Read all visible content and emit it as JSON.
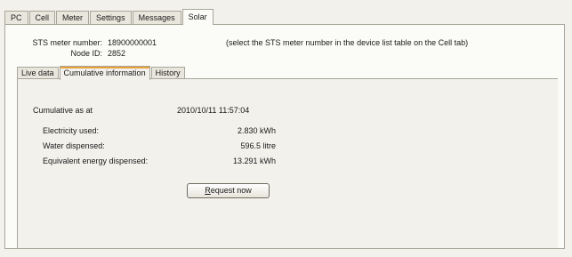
{
  "top_tabs": [
    "PC",
    "Cell",
    "Meter",
    "Settings",
    "Messages",
    "Solar"
  ],
  "meter": {
    "sts_label": "STS meter number:",
    "sts_value": "18900000001",
    "node_label": "Node ID:",
    "node_value": "2852",
    "hint": "(select the STS meter number in the device list table on the Cell tab)"
  },
  "inner_tabs": [
    "Live data",
    "Cumulative information",
    "History"
  ],
  "cumulative": {
    "as_at_label": "Cumulative as at",
    "as_at_value": "2010/10/11 11:57:04",
    "electricity_label": "Electricity used:",
    "electricity_value": "2.830 kWh",
    "water_label": "Water dispensed:",
    "water_value": "596.5 litre",
    "energy_label": "Equivalent energy dispensed:",
    "energy_value": "13.291 kWh"
  },
  "button": {
    "mnemonic": "R",
    "rest": "equest now"
  }
}
